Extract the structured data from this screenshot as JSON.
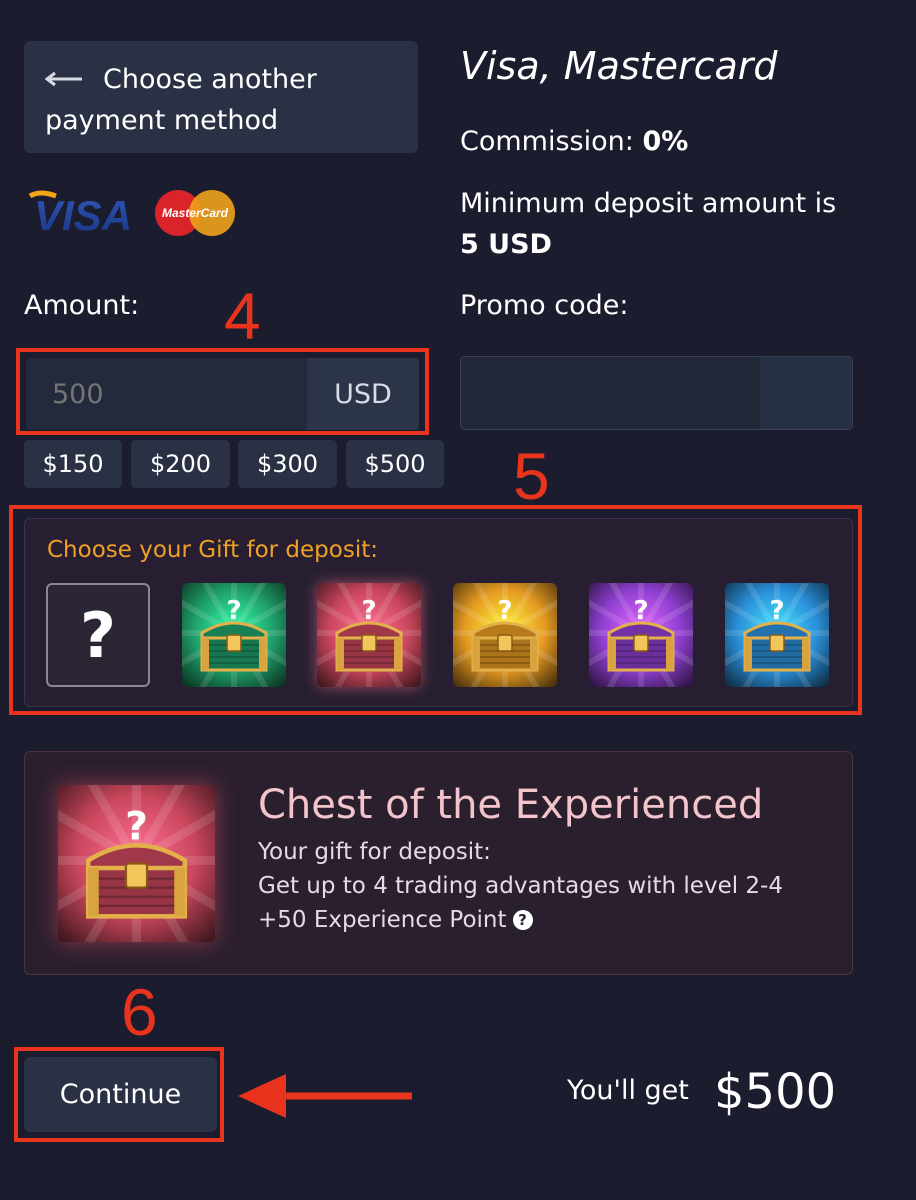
{
  "back_button": {
    "label": "Choose another payment method"
  },
  "logos": {
    "visa": "VISA",
    "mastercard": "MasterCard"
  },
  "method": {
    "title": "Visa, Mastercard",
    "commission_label": "Commission:",
    "commission_value": "0%",
    "min_deposit_label": "Minimum deposit amount is",
    "min_deposit_value": "5 USD",
    "promo_label": "Promo code:",
    "promo_value": ""
  },
  "amount": {
    "label": "Amount:",
    "placeholder": "500",
    "currency": "USD",
    "presets": [
      "$150",
      "$200",
      "$300",
      "$500"
    ]
  },
  "gift": {
    "title": "Choose your Gift for deposit:",
    "unknown_symbol": "?",
    "chests": [
      {
        "name": "green-chest",
        "color": "#1fa06a"
      },
      {
        "name": "red-chest",
        "color": "#c9465c",
        "selected": true
      },
      {
        "name": "gold-chest",
        "color": "#e59a22"
      },
      {
        "name": "purple-chest",
        "color": "#8f3fd0"
      },
      {
        "name": "blue-chest",
        "color": "#2a8fd8"
      }
    ]
  },
  "featured": {
    "name": "Chest of the Experienced",
    "subtitle": "Your gift for deposit:",
    "line1": "Get up to 4 trading advantages with level 2-4",
    "line2": "+50 Experience Point",
    "help_symbol": "?"
  },
  "annotations": {
    "step4": "4",
    "step5": "5",
    "step6": "6"
  },
  "actions": {
    "continue_label": "Continue",
    "you_get_label": "You'll get",
    "you_get_value": "$500"
  },
  "colors": {
    "background": "#1b1c2e",
    "accent_red": "#e8341c",
    "gift_title": "#f0a025",
    "chest_name": "#f4c4cc"
  }
}
